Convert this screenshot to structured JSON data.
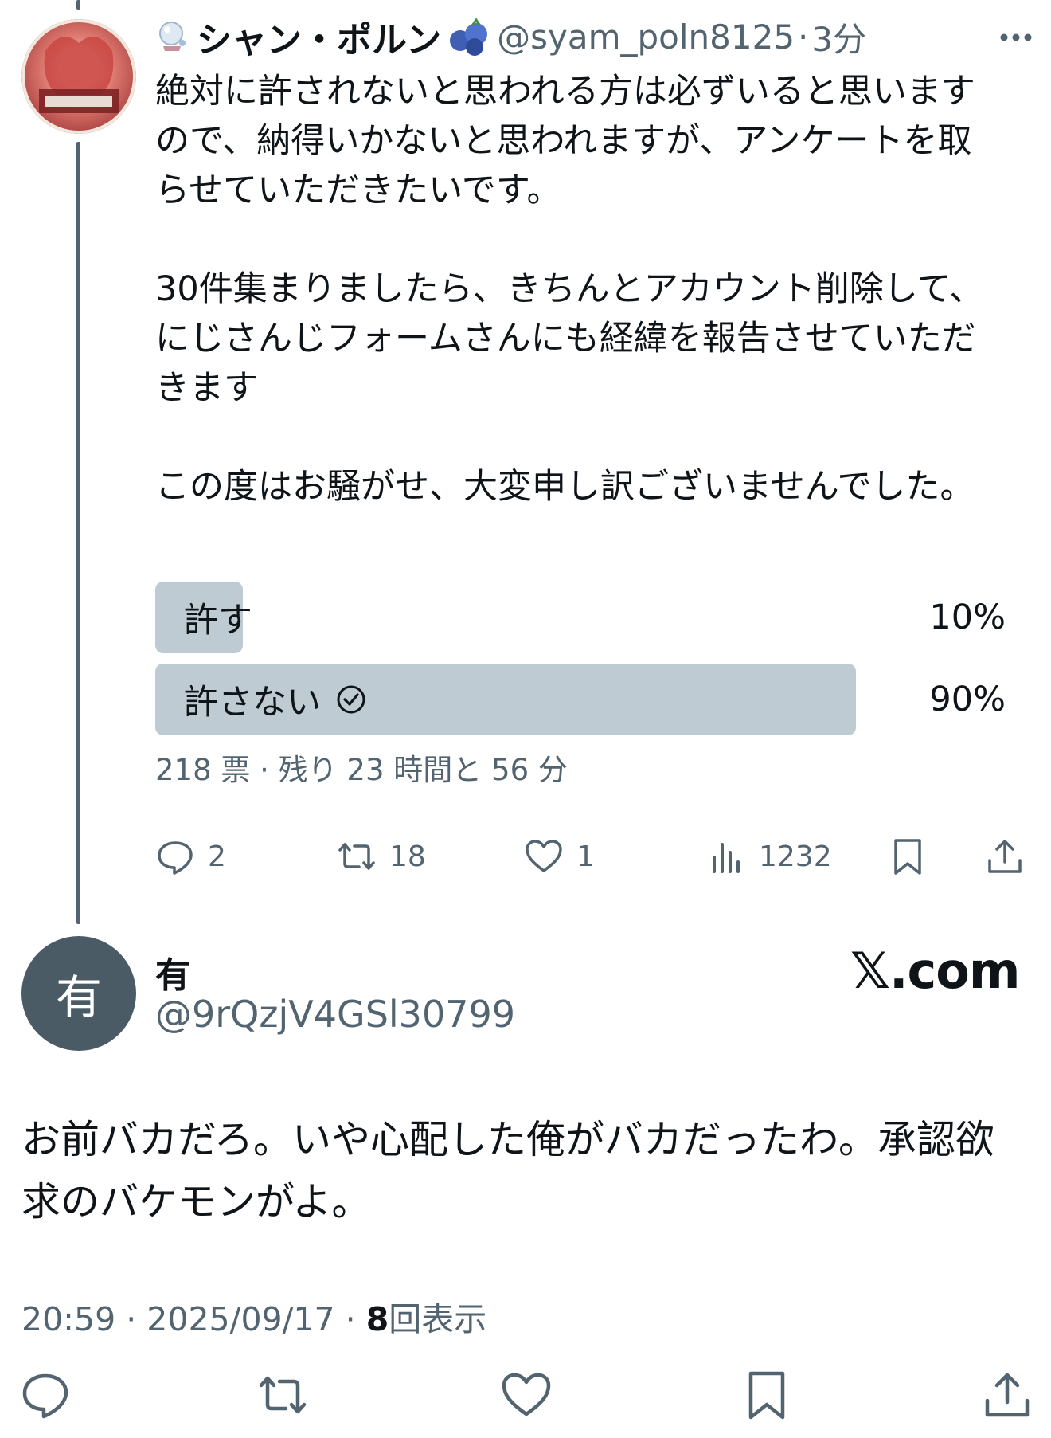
{
  "parent_tweet": {
    "display_name": "シャン・ポルン",
    "handle": "@syam_poln8125",
    "separator": "·",
    "time": "3分",
    "body_paragraphs": [
      "絶対に許されないと思われる方は必ずいると思いますので、納得いかないと思われますが、アンケートを取らせていただきたいです。",
      "30件集まりましたら、きちんとアカウント削除して、にじさんじフォームさんにも経緯を報告させていただきます",
      "この度はお騒がせ、大変申し訳ございませんでした。"
    ],
    "poll": {
      "options": [
        {
          "label": "許す",
          "percent_text": "10%",
          "percent": 10,
          "selected": false
        },
        {
          "label": "許さない",
          "percent_text": "90%",
          "percent": 90,
          "selected": true
        }
      ],
      "meta": "218 票 · 残り 23 時間と 56 分"
    },
    "actions": {
      "replies": "2",
      "retweets": "18",
      "likes": "1",
      "views": "1232"
    },
    "icons": [
      "more-icon",
      "reply-icon",
      "retweet-icon",
      "like-icon",
      "views-icon",
      "bookmark-icon",
      "share-icon"
    ]
  },
  "reply_tweet": {
    "avatar_text": "有",
    "display_name": "有",
    "handle": "@9rQzjV4GSl30799",
    "brand": "𝕏.com",
    "body": "お前バカだろ。いや心配した俺がバカだったわ。承認欲求のバケモンがよ。",
    "time": "20:59",
    "date": "2025/09/17",
    "sep": "·",
    "views_count": "8",
    "views_label": "回表示",
    "icons": [
      "reply-icon",
      "retweet-icon",
      "like-icon",
      "bookmark-icon",
      "share-icon"
    ]
  },
  "colors": {
    "text": "#0f1419",
    "secondary": "#536471",
    "poll_fill": "#bfcbd2",
    "thread_line": "#536471",
    "avatar_bg": "#4b5b66"
  }
}
